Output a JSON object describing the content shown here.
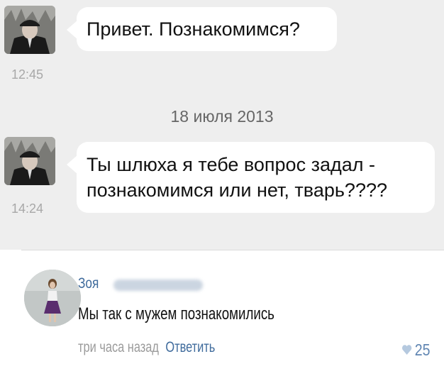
{
  "messages": [
    {
      "text_lines": [
        "Привет. Познакомимся?"
      ],
      "time": "12:45",
      "avatar": "man-in-cap-photo"
    },
    {
      "text_lines": [
        "Ты шлюха я тебе вопрос задал -",
        "познакомимся или нет, тварь????"
      ],
      "time": "14:24",
      "avatar": "man-in-cap-photo"
    }
  ],
  "date_separator": "18 июля 2013",
  "comment": {
    "author_first": "Зоя",
    "author_last_hidden": true,
    "text": "Мы так с мужем познакомились",
    "time": "три часа назад",
    "reply_label": "Ответить",
    "likes": "25",
    "like_icon": "heart-icon",
    "avatar": "woman-in-dress-photo"
  },
  "colors": {
    "chat_bg": "#eeeeee",
    "bubble_bg": "#ffffff",
    "link_blue": "#3f6b9c",
    "muted_gray": "#a8a8a8",
    "like_blue": "#9fb8d4"
  }
}
